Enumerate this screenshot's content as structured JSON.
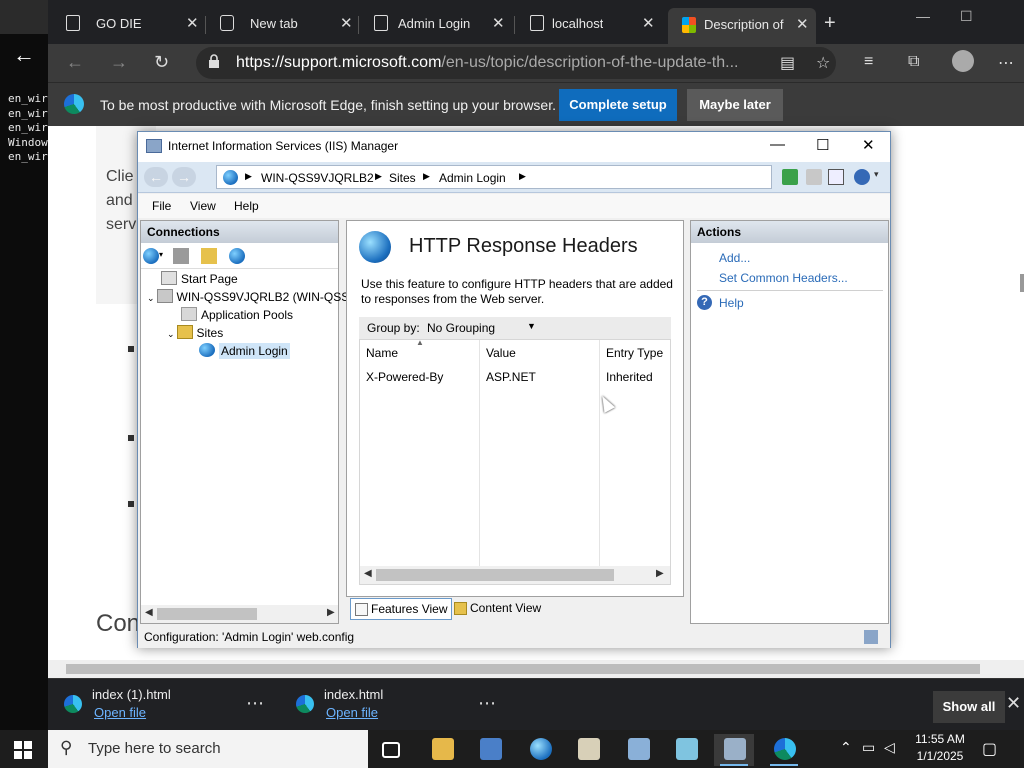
{
  "console": {
    "lines": "en_wir\nen_wir\nen_wir\nWindow\nen_wir"
  },
  "browser": {
    "tabs": [
      {
        "label": "GO DIE"
      },
      {
        "label": "New tab"
      },
      {
        "label": "Admin Login"
      },
      {
        "label": "localhost"
      },
      {
        "label": "Description of t"
      }
    ],
    "url_host": "https://support.microsoft.com",
    "url_path": "/en-us/topic/description-of-the-update-th...",
    "setup_message": "To be most productive with Microsoft Edge, finish setting up your browser.",
    "complete_setup_label": "Complete setup",
    "maybe_later_label": "Maybe later",
    "page_fragments": {
      "clie": "Clie",
      "and": "and",
      "serv": "serv",
      "con": "Con"
    }
  },
  "iis": {
    "title": "Internet Information Services (IIS) Manager",
    "breadcrumb": [
      "WIN-QSS9VJQRLB2",
      "Sites",
      "Admin Login"
    ],
    "menu": [
      "File",
      "View",
      "Help"
    ],
    "connections": {
      "header": "Connections",
      "tree": [
        {
          "label": "Start Page"
        },
        {
          "label": "WIN-QSS9VJQRLB2 (WIN-QSS"
        },
        {
          "label": "Application Pools"
        },
        {
          "label": "Sites"
        },
        {
          "label": "Admin Login"
        }
      ]
    },
    "feature": {
      "title": "HTTP Response Headers",
      "description": "Use this feature to configure HTTP headers that are added to responses from the Web server.",
      "group_by_label": "Group by:",
      "group_by_value": "No Grouping",
      "columns": [
        "Name",
        "Value",
        "Entry Type"
      ],
      "rows": [
        {
          "name": "X-Powered-By",
          "value": "ASP.NET",
          "entry_type": "Inherited"
        }
      ],
      "features_view_label": "Features View",
      "content_view_label": "Content View"
    },
    "actions": {
      "header": "Actions",
      "add": "Add...",
      "set_common": "Set Common Headers...",
      "help": "Help"
    },
    "status": "Configuration: 'Admin Login' web.config"
  },
  "downloads": {
    "items": [
      {
        "name": "index (1).html",
        "open": "Open file"
      },
      {
        "name": "index.html",
        "open": "Open file"
      }
    ],
    "show_all": "Show all"
  },
  "taskbar": {
    "search_placeholder": "Type here to search",
    "time": "11:55 AM",
    "date": "1/1/2025"
  },
  "colors": {
    "edge_accent": "#0f6cbd",
    "link": "#2a6bb8"
  }
}
